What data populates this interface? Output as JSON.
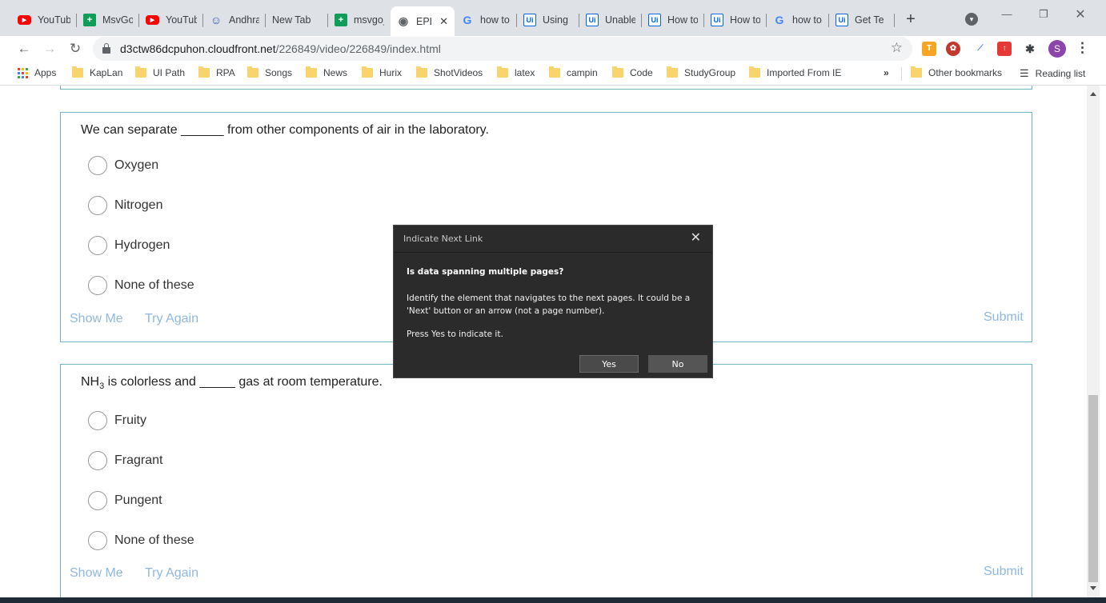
{
  "browser": {
    "tabs": [
      {
        "label": "YouTub",
        "icon": "youtube-icon"
      },
      {
        "label": "MsvGo",
        "icon": "sheets-icon"
      },
      {
        "label": "YouTub",
        "icon": "youtube-icon"
      },
      {
        "label": "Andhra",
        "icon": "andhra-icon"
      },
      {
        "label": "New Tab",
        "icon": ""
      },
      {
        "label": "msvgo_",
        "icon": "sheets-icon"
      },
      {
        "label": "EPL",
        "icon": "globe-icon",
        "active": true
      },
      {
        "label": "how to",
        "icon": "google-icon"
      },
      {
        "label": "Using",
        "icon": "uipath-icon"
      },
      {
        "label": "Unable",
        "icon": "uipath-icon"
      },
      {
        "label": "How to",
        "icon": "uipath-icon"
      },
      {
        "label": "How to",
        "icon": "uipath-icon"
      },
      {
        "label": "how to",
        "icon": "google-icon"
      },
      {
        "label": "Get Te",
        "icon": "uipath-icon"
      }
    ],
    "url_host": "d3ctw86dcpuhon.cloudfront.net",
    "url_path": "/226849/video/226849/index.html",
    "profile_initial": "S",
    "bookmarks": [
      "Apps",
      "KapLan",
      "UI Path",
      "RPA",
      "Songs",
      "News",
      "Hurix",
      "ShotVideos",
      "latex",
      "campin",
      "Code",
      "StudyGroup",
      "Imported From IE"
    ],
    "other_bookmarks": "Other bookmarks",
    "reading_list": "Reading list",
    "overflow": "»"
  },
  "questions": [
    {
      "text": "We can separate ______ from other components of air in the laboratory.",
      "options": [
        "Oxygen",
        "Nitrogen",
        "Hydrogen",
        "None of these"
      ],
      "show_me": "Show Me",
      "try_again": "Try Again",
      "submit": "Submit"
    },
    {
      "text_prefix": "NH",
      "text_sub": "3",
      "text_suffix": " is colorless and _____ gas at room temperature.",
      "options": [
        "Fruity",
        "Fragrant",
        "Pungent",
        "None of these"
      ],
      "show_me": "Show Me",
      "try_again": "Try Again",
      "submit": "Submit"
    }
  ],
  "dialog": {
    "title": "Indicate Next Link",
    "close": "✕",
    "heading": "Is data spanning multiple pages?",
    "body": "Identify the element that navigates to the next pages. It could be a 'Next' button or an arrow (not a page number).",
    "hint": "Press Yes to indicate it.",
    "yes_label": "Yes",
    "no_label": "No"
  },
  "colors": {
    "card_border": "#6fb4c4",
    "link": "#8fb8de",
    "dialog_bg": "#2b2b2b"
  }
}
